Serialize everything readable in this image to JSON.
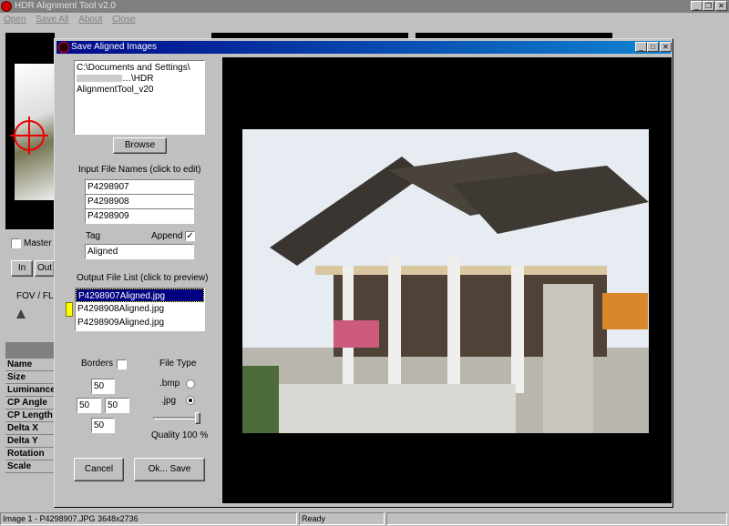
{
  "main_window": {
    "title": "HDR Alignment Tool  v2.0",
    "controls": {
      "minimize": "_",
      "restore": "❐",
      "close": "✕"
    }
  },
  "menu": [
    "Open",
    "Save All",
    "About",
    "Close"
  ],
  "background": {
    "master_label": "Master",
    "in_label": "In",
    "out_label": "Out",
    "fov_label": "FOV / FL",
    "table_rows": [
      "Name",
      "Size",
      "Luminance",
      "CP Angle",
      "CP Length",
      "Delta X",
      "Delta Y",
      "Rotation",
      "Scale"
    ]
  },
  "dialog": {
    "title": "Save Aligned Images",
    "controls": {
      "minimize": "_",
      "maximize": "□",
      "close": "✕"
    },
    "path_line1": "C:\\Documents and Settings\\",
    "path_line2": "…\\HDR",
    "path_line3": "AlignmentTool_v20",
    "browse_label": "Browse",
    "input_files_label": "Input File Names  (click to edit)",
    "input_files": [
      "P4298907",
      "P4298908",
      "P4298909"
    ],
    "tag_label": "Tag",
    "append_label": "Append",
    "append_checked": "✓",
    "tag_value": "Aligned",
    "output_list_label": "Output File List  (click to preview)",
    "output_files": [
      "P4298907Aligned.jpg",
      "P4298908Aligned.jpg",
      "P4298909Aligned.jpg"
    ],
    "borders_label": "Borders",
    "file_type_label": "File Type",
    "border_values": {
      "top": "50",
      "left": "50",
      "right": "50",
      "bottom": "50"
    },
    "bmp_label": ".bmp",
    "jpg_label": ".jpg",
    "quality_label": "Quality 100 %",
    "quality": 100,
    "cancel_label": "Cancel",
    "save_label": "Ok... Save"
  },
  "status_bar": {
    "image_info": "Image 1 - P4298907.JPG   3648x2736",
    "state": "Ready"
  },
  "colors": {
    "dialog_title_start": "#00088a",
    "dialog_title_end": "#1084d0",
    "selection": "#000080",
    "marker_yellow": "#ffff00"
  }
}
